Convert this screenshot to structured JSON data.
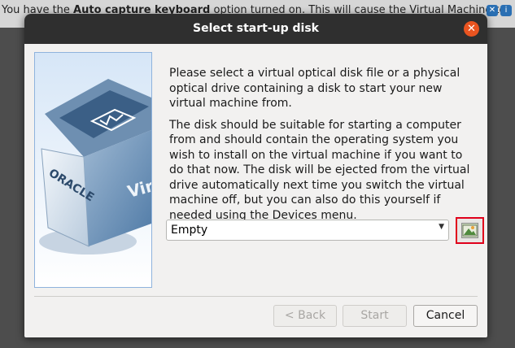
{
  "notification": {
    "text_prefix": "You have the ",
    "text_bold": "Auto capture keyboard",
    "text_suffix": " option turned on. This will cause the Virtual Machine to"
  },
  "dialog": {
    "title": "Select start-up disk",
    "paragraph1": "Please select a virtual optical disk file or a physical optical drive containing a disk to start your new virtual machine from.",
    "paragraph2": "The disk should be suitable for starting a computer from and should contain the operating system you wish to install on the virtual machine if you want to do that now. The disk will be ejected from the virtual drive automatically next time you switch the virtual machine off, but you can also do this yourself if needed using the Devices menu.",
    "disk_select_value": "Empty",
    "logo_text": "ORACLE",
    "logo_text2": "Virt",
    "buttons": {
      "back": "< Back",
      "start": "Start",
      "cancel": "Cancel"
    }
  },
  "icons": {
    "close": "close-icon",
    "choose_disk": "folder-icon",
    "dropdown": "chevron-down-icon"
  },
  "colors": {
    "accent_close": "#e95420",
    "highlight_border": "#e0001b",
    "titlebar": "#2f2f2f"
  }
}
